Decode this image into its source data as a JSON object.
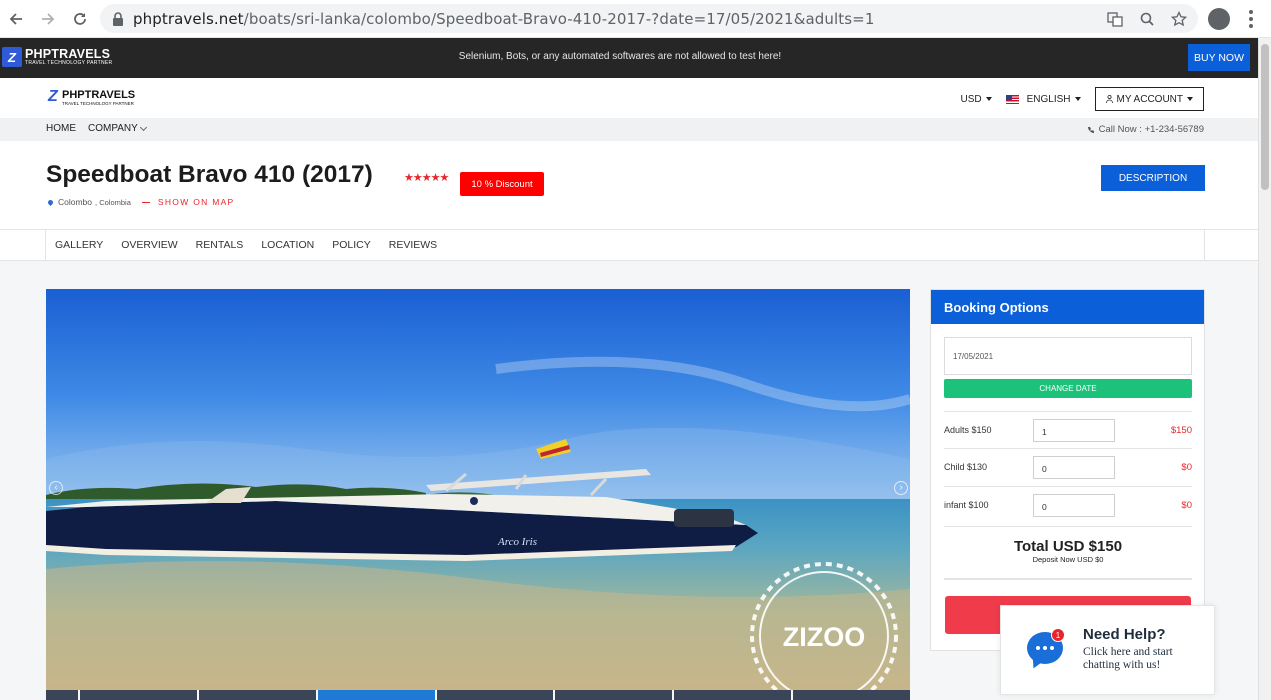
{
  "browser": {
    "url_domain": "phptravels.net",
    "url_path": "/boats/sri-lanka/colombo/Speedboat-Bravo-410-2017-?date=17/05/2021&adults=1"
  },
  "topbar": {
    "logo_title": "PHPTRAVELS",
    "logo_subtitle": "TRAVEL TECHNOLOGY PARTNER",
    "notice": "Selenium, Bots, or any automated softwares are not allowed to test here!",
    "buy_now": "BUY NOW"
  },
  "header": {
    "logo_title": "PHPTRAVELS",
    "logo_subtitle": "TRAVEL TECHNOLOGY PARTNER",
    "currency": "USD",
    "language": "ENGLISH",
    "account": "MY ACCOUNT"
  },
  "nav": {
    "home": "HOME",
    "company": "COMPANY",
    "call": "Call Now : +1-234-56789"
  },
  "listing": {
    "title": "Speedboat Bravo 410 (2017)",
    "stars": "★★★★★",
    "rating": 5,
    "discount": "10 % Discount",
    "location_city": "Colombo",
    "location_country": " , Colombia",
    "show_on_map": "SHOW ON MAP",
    "description_btn": "DESCRIPTION"
  },
  "tabs": [
    "GALLERY",
    "OVERVIEW",
    "RENTALS",
    "LOCATION",
    "POLICY",
    "REVIEWS"
  ],
  "gallery": {
    "watermark": "ZIZOO",
    "hull_text": "Arco Iris"
  },
  "booking": {
    "title": "Booking Options",
    "date": "17/05/2021",
    "change_date": "CHANGE DATE",
    "rows": [
      {
        "label": "Adults $150",
        "qty": "1",
        "price": "$150"
      },
      {
        "label": "Child $130",
        "qty": "0",
        "price": "$0"
      },
      {
        "label": "infant $100",
        "qty": "0",
        "price": "$0"
      }
    ],
    "total": "Total USD $150",
    "deposit": "Deposit Now USD $0"
  },
  "help": {
    "title": "Need Help?",
    "subtitle": "Click here and start chatting with us!",
    "badge": "1"
  },
  "colors": {
    "brand_blue": "#0b5fd9",
    "discount_red": "#ff0000",
    "change_date_green": "#1cc27a",
    "price_red": "#e8252b"
  }
}
